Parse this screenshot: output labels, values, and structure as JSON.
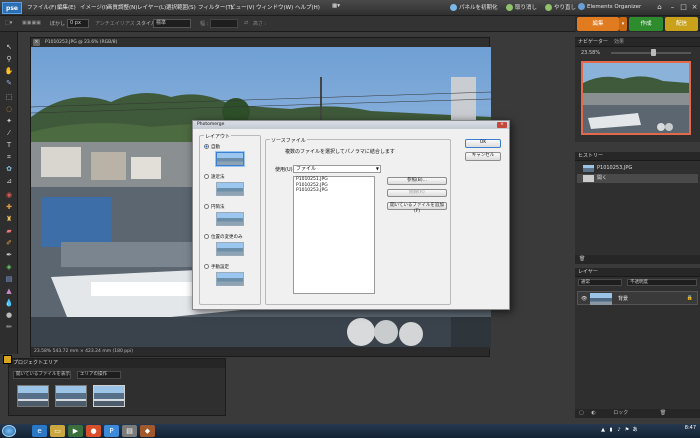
{
  "app": {
    "logo": "pse"
  },
  "menubar": {
    "items": [
      "ファイル(F)",
      "編集(E)",
      "イメージ(I)",
      "画質調整(N)",
      "レイヤー(L)",
      "選択範囲(S)",
      "フィルター(T)",
      "ビュー(V)",
      "ウィンドウ(W)",
      "ヘルプ(H)"
    ],
    "right": [
      "パネルを初期化",
      "取り消し",
      "やり直し",
      "Elements Organizer"
    ]
  },
  "optionsbar": {
    "feather_label": "ぼかし :",
    "feather_value": "0 px",
    "antialias": "アンチエイリアス",
    "style_label": "スタイル :",
    "style_value": "標準",
    "width_label": "幅 :",
    "height_label": "高さ :"
  },
  "modetabs": {
    "edit": "編集",
    "create": "作成",
    "share": "配信"
  },
  "document": {
    "title": "P1010253.JPG @ 23.6% (RGB/8)",
    "status": "23.58%   543.72 mm × 423.24 mm (180 ppi)"
  },
  "dialog": {
    "title": "Photomerge",
    "layout_label": "レイアウト",
    "layouts": [
      "自動",
      "遠近法",
      "円筒法",
      "位置の変更のみ",
      "手動設定"
    ],
    "source_label": "ソースファイル",
    "instruction": "複数のファイルを選択してパノラマに結合します",
    "use_label": "使用(U) :",
    "use_value": "ファイル",
    "files": [
      "P1010251.JPG",
      "P1010252.JPG",
      "P1010253.JPG"
    ],
    "browse": "参照(B)...",
    "remove": "削除(R)",
    "add_open": "開いているファイルを追加(F)",
    "ok": "OK",
    "cancel": "キャンセル"
  },
  "navigator": {
    "title": "ナビゲーター",
    "tab2": "効果",
    "zoom": "23.58%"
  },
  "history": {
    "title": "ヒストリー",
    "rows": [
      "P1010253.JPG",
      "開く"
    ]
  },
  "layers": {
    "title": "レイヤー",
    "blend": "通常",
    "opacity": "不透明度",
    "layer_name": "背景",
    "footer": "ロック"
  },
  "projectbin": {
    "title": "プロジェクトエリア",
    "option1": "開いているファイルを表示",
    "option2": "エリアの操作"
  },
  "taskbar": {
    "time": "8:47"
  },
  "colors": {
    "accent_edit": "#e07b1f",
    "accent_create": "#2e8b2e",
    "accent_share": "#c9a21a",
    "nav_frame": "#e26a4b"
  }
}
